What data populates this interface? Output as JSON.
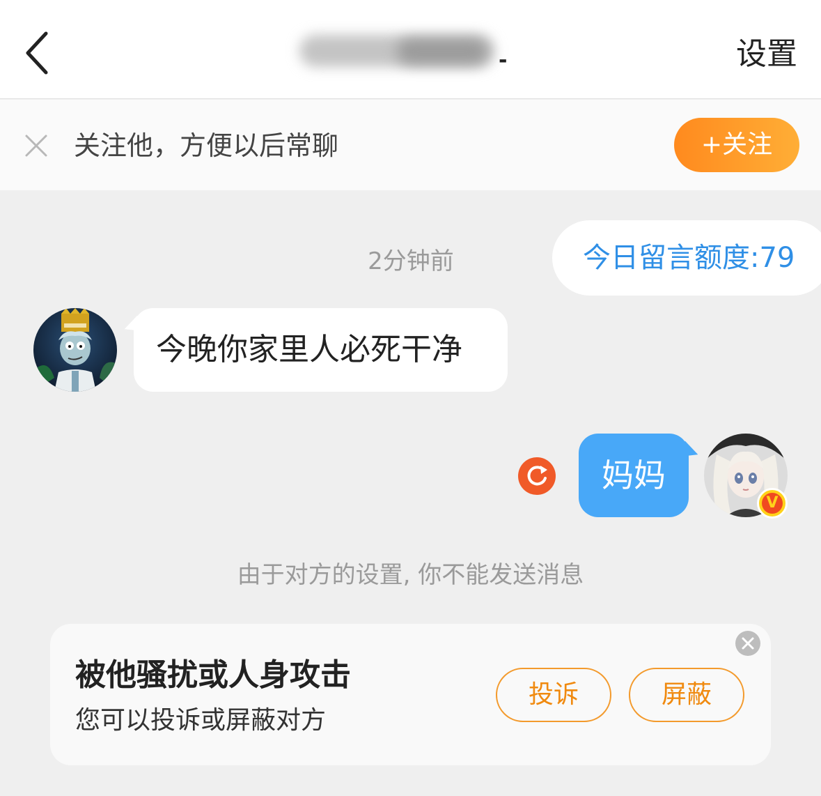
{
  "header": {
    "title_suffix": "-",
    "settings_label": "设置"
  },
  "follow_prompt": {
    "text": "关注他，方便以后常聊",
    "button_label": "+关注"
  },
  "chat": {
    "quota_label": "今日留言额度:79",
    "timestamp": "2分钟前",
    "messages": [
      {
        "direction": "incoming",
        "text": "今晚你家里人必死干净"
      },
      {
        "direction": "outgoing",
        "text": "妈妈",
        "status": "failed"
      }
    ],
    "verified_badge": "V",
    "blocked_notice": "由于对方的设置, 你不能发送消息"
  },
  "report_card": {
    "title": "被他骚扰或人身攻击",
    "subtitle": "您可以投诉或屏蔽对方",
    "report_label": "投诉",
    "block_label": "屏蔽"
  },
  "colors": {
    "accent_orange": "#ff9a26",
    "link_blue": "#2f8fe6",
    "outgoing_bubble": "#48a8f8",
    "retry_red": "#f05a28"
  }
}
